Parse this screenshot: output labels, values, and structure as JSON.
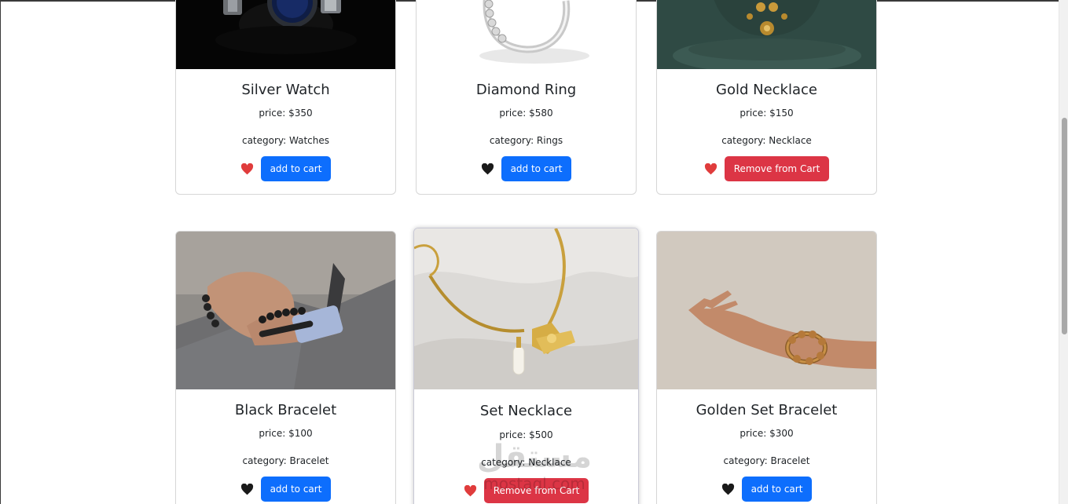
{
  "products": [
    {
      "name": "Silver Watch",
      "price": "price: $350",
      "category": "category: Watches",
      "favorite": true,
      "button": "add to cart",
      "button_type": "add"
    },
    {
      "name": "Diamond Ring",
      "price": "price: $580",
      "category": "category: Rings",
      "favorite": false,
      "button": "add to cart",
      "button_type": "add"
    },
    {
      "name": "Gold Necklace",
      "price": "price: $150",
      "category": "category: Necklace",
      "favorite": true,
      "button": "Remove from Cart",
      "button_type": "remove"
    },
    {
      "name": "Black Bracelet",
      "price": "price: $100",
      "category": "category: Bracelet",
      "favorite": false,
      "button": "add to cart",
      "button_type": "add"
    },
    {
      "name": "Set Necklace",
      "price": "price: $500",
      "category": "category: Necklace",
      "favorite": true,
      "button": "Remove from Cart",
      "button_type": "remove"
    },
    {
      "name": "Golden Set Bracelet",
      "price": "price: $300",
      "category": "category: Bracelet",
      "favorite": false,
      "button": "add to cart",
      "button_type": "add"
    }
  ],
  "icons": {
    "favorite": "heart-icon"
  },
  "colors": {
    "primary": "#0d6efd",
    "danger": "#dc3545",
    "heart_active": "#e03c3c",
    "heart_inactive": "#1a1a1a"
  },
  "watermark": {
    "arabic": "مستقل",
    "latin": "mostaql.com"
  }
}
